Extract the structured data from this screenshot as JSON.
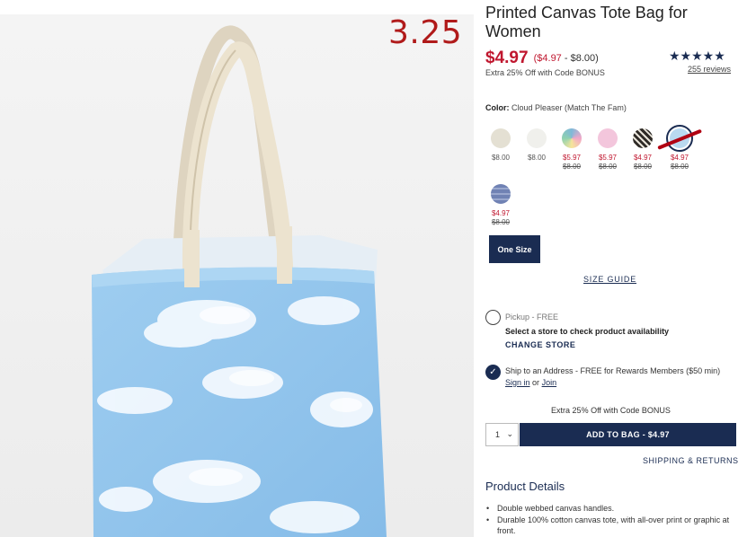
{
  "annotation": "3.25",
  "product": {
    "title": "Printed Canvas Tote Bag for Women",
    "price": "$4.97",
    "price_range_red": "($4.97",
    "price_range_rest": " - $8.00)",
    "promo": "Extra 25% Off with Code BONUS",
    "stars": "★★★★★",
    "rating": 5,
    "reviews": "255 reviews"
  },
  "color": {
    "label": "Color:",
    "value": "Cloud Pleaser (Match The Fam)",
    "swatches": [
      {
        "name": "Beige",
        "color": "#e4e0d3",
        "reg": "$8.00"
      },
      {
        "name": "Off White",
        "color": "#f0f0ec",
        "reg": "$8.00"
      },
      {
        "name": "Tie Dye",
        "color": "#7fb8d8",
        "sale": "$5.97",
        "orig": "$8.00"
      },
      {
        "name": "Pink",
        "color": "#f3c6dc",
        "sale": "$5.97",
        "orig": "$8.00"
      },
      {
        "name": "Leaf Print",
        "color": "#3a3530",
        "sale": "$4.97",
        "orig": "$8.00"
      },
      {
        "name": "Cloud Pleaser",
        "color": "#b9d9f0",
        "sale": "$4.97",
        "orig": "$8.00"
      },
      {
        "name": "Plaid",
        "color": "#a9b6d6",
        "sale": "$4.97",
        "orig": "$8.00"
      }
    ]
  },
  "size": {
    "label": "One Size",
    "guide": "SIZE GUIDE"
  },
  "fulfillment": {
    "pickup_label": "Pickup - FREE",
    "pickup_desc": "Select a store to check product availability",
    "change_store": "CHANGE STORE",
    "ship_text": "Ship to an Address - FREE for Rewards Members ($50 min)",
    "sign_in": "Sign in",
    "or": "or",
    "join": "Join"
  },
  "cart": {
    "promo": "Extra 25% Off with Code BONUS",
    "qty": "1",
    "add_to_bag": "ADD TO BAG  -  $4.97",
    "shipping_returns": "SHIPPING & RETURNS"
  },
  "details": {
    "title": "Product Details",
    "items": [
      "Double webbed canvas handles.",
      "Durable 100% cotton canvas tote, with all-over print or graphic at front."
    ]
  },
  "colors": {
    "navy": "#1a2c52",
    "sale_red": "#c0172f"
  }
}
